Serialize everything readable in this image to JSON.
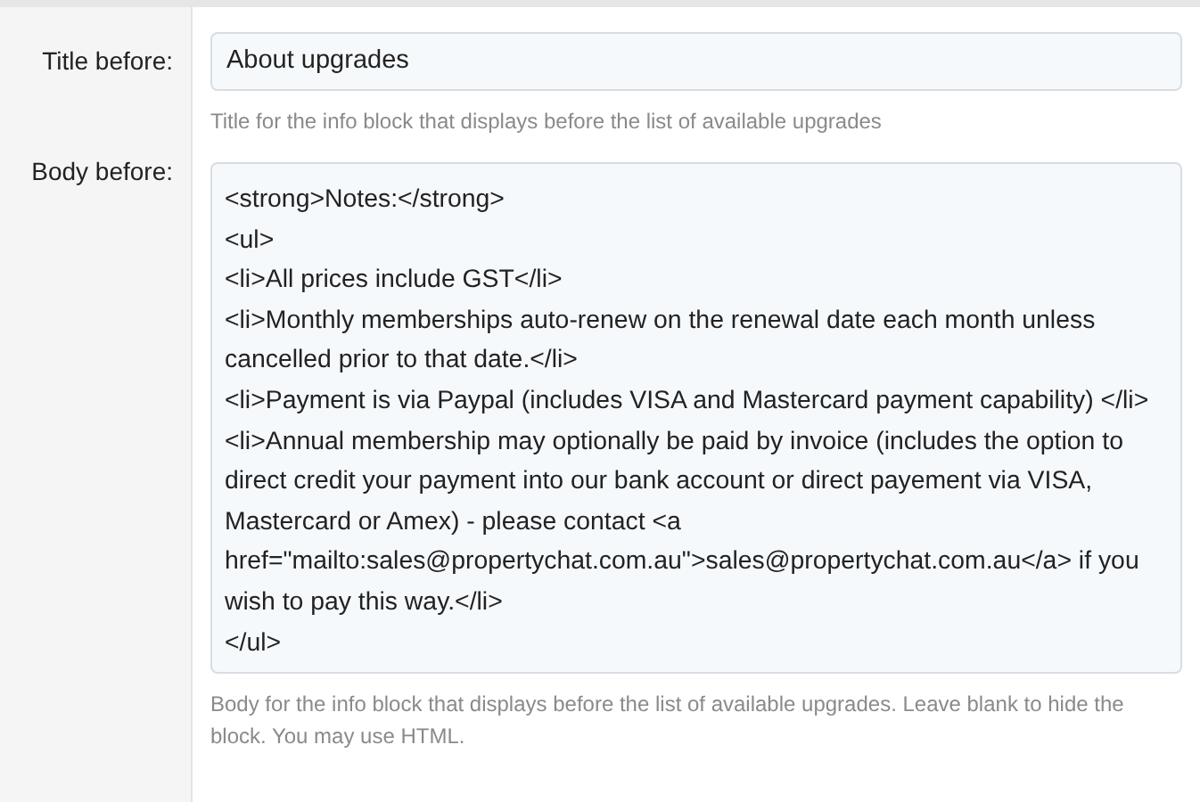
{
  "fields": [
    {
      "kind": "input",
      "label": "Title before:",
      "value": "About upgrades",
      "help": "Title for the info block that displays before the list of available upgrades"
    },
    {
      "kind": "textarea",
      "label": "Body before:",
      "value": "<strong>Notes:</strong>\n<ul>\n<li>All prices include GST</li>\n<li>Monthly memberships auto-renew on the renewal date each month unless cancelled prior to that date.</li>\n<li>Payment is via Paypal (includes VISA and Mastercard payment capability) </li>\n<li>Annual membership may optionally be paid by invoice (includes the option to direct credit your payment into our bank account or direct payement via VISA, Mastercard or Amex) - please contact <a href=\"mailto:sales@propertychat.com.au\">sales@propertychat.com.au</a> if you wish to pay this way.</li>\n</ul>",
      "help": "Body for the info block that displays before the list of available upgrades. Leave blank to hide the block. You may use HTML."
    }
  ]
}
